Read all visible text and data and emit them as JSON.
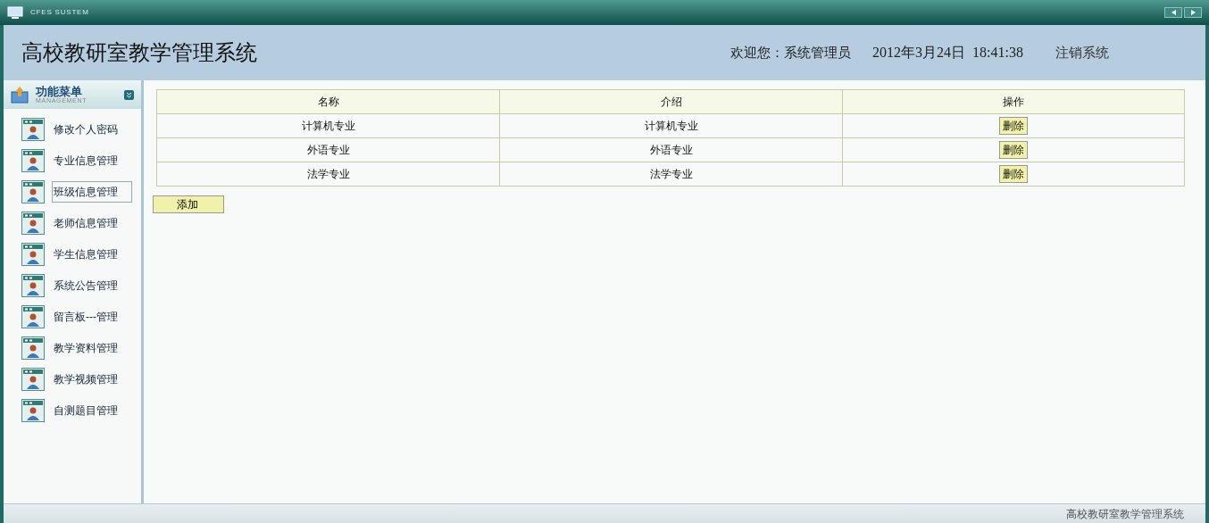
{
  "window": {
    "title": "CFES SUSTEM"
  },
  "header": {
    "title": "高校教研室教学管理系统",
    "welcome": "欢迎您：系统管理员",
    "datetime": "2012年3月24日  18:41:38",
    "logout": "注销系统"
  },
  "sidebar": {
    "title": "功能菜单",
    "subtitle": "MANAGEMENT",
    "items": [
      {
        "label": "修改个人密码",
        "highlighted": false
      },
      {
        "label": "专业信息管理",
        "highlighted": false
      },
      {
        "label": "班级信息管理",
        "highlighted": true
      },
      {
        "label": "老师信息管理",
        "highlighted": false
      },
      {
        "label": "学生信息管理",
        "highlighted": false
      },
      {
        "label": "系统公告管理",
        "highlighted": false
      },
      {
        "label": "留言板---管理",
        "highlighted": false
      },
      {
        "label": "教学资料管理",
        "highlighted": false
      },
      {
        "label": "教学视频管理",
        "highlighted": false
      },
      {
        "label": "自测题目管理",
        "highlighted": false
      }
    ]
  },
  "table": {
    "columns": [
      "名称",
      "介绍",
      "操作"
    ],
    "rows": [
      {
        "name": "计算机专业",
        "intro": "计算机专业",
        "action": "删除"
      },
      {
        "name": "外语专业",
        "intro": "外语专业",
        "action": "删除"
      },
      {
        "name": "法学专业",
        "intro": "法学专业",
        "action": "删除"
      }
    ]
  },
  "add_button": "添加",
  "status_bar": "高校教研室教学管理系统"
}
